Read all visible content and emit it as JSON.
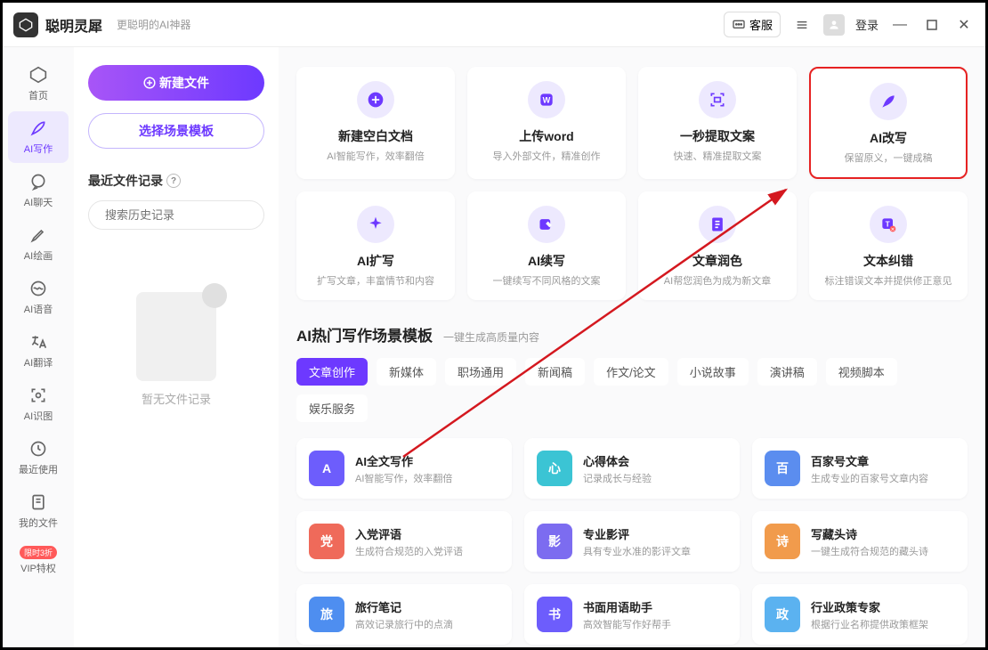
{
  "app": {
    "name": "聪明灵犀",
    "tagline": "更聪明的AI神器"
  },
  "titlebar": {
    "kefu": "客服",
    "login": "登录"
  },
  "sidebar": {
    "items": [
      {
        "label": "首页"
      },
      {
        "label": "AI写作"
      },
      {
        "label": "AI聊天"
      },
      {
        "label": "AI绘画"
      },
      {
        "label": "AI语音"
      },
      {
        "label": "AI翻译"
      },
      {
        "label": "AI识图"
      },
      {
        "label": "最近使用"
      },
      {
        "label": "我的文件"
      },
      {
        "label": "VIP特权"
      }
    ],
    "vip_badge": "限时3折"
  },
  "left": {
    "new_file": "新建文件",
    "select_tpl": "选择场景模板",
    "recent_title": "最近文件记录",
    "search_placeholder": "搜索历史记录",
    "empty": "暂无文件记录"
  },
  "cards": [
    {
      "title": "新建空白文档",
      "desc": "AI智能写作，效率翻倍"
    },
    {
      "title": "上传word",
      "desc": "导入外部文件，精准创作"
    },
    {
      "title": "一秒提取文案",
      "desc": "快速、精准提取文案"
    },
    {
      "title": "AI改写",
      "desc": "保留原义，一键成稿"
    },
    {
      "title": "AI扩写",
      "desc": "扩写文章，丰富情节和内容"
    },
    {
      "title": "AI续写",
      "desc": "一键续写不同风格的文案"
    },
    {
      "title": "文章润色",
      "desc": "AI帮您润色为成为新文章"
    },
    {
      "title": "文本纠错",
      "desc": "标注错误文本并提供修正意见"
    }
  ],
  "section": {
    "title": "AI热门写作场景模板",
    "sub": "一键生成高质量内容"
  },
  "tabs": [
    "文章创作",
    "新媒体",
    "职场通用",
    "新闻稿",
    "作文/论文",
    "小说故事",
    "演讲稿",
    "视频脚本",
    "娱乐服务"
  ],
  "templates": [
    {
      "title": "AI全文写作",
      "desc": "AI智能写作，效率翻倍",
      "color": "#6d5dfc"
    },
    {
      "title": "心得体会",
      "desc": "记录成长与经验",
      "color": "#3bc4d4"
    },
    {
      "title": "百家号文章",
      "desc": "生成专业的百家号文章内容",
      "color": "#5b8def"
    },
    {
      "title": "入党评语",
      "desc": "生成符合规范的入党评语",
      "color": "#ef6a5a"
    },
    {
      "title": "专业影评",
      "desc": "具有专业水准的影评文章",
      "color": "#7c6cf0"
    },
    {
      "title": "写藏头诗",
      "desc": "一键生成符合规范的藏头诗",
      "color": "#f19b4c"
    },
    {
      "title": "旅行笔记",
      "desc": "高效记录旅行中的点滴",
      "color": "#4e8ef0"
    },
    {
      "title": "书面用语助手",
      "desc": "高效智能写作好帮手",
      "color": "#6d5dfc"
    },
    {
      "title": "行业政策专家",
      "desc": "根据行业名称提供政策框架",
      "color": "#5bb2f0"
    }
  ]
}
